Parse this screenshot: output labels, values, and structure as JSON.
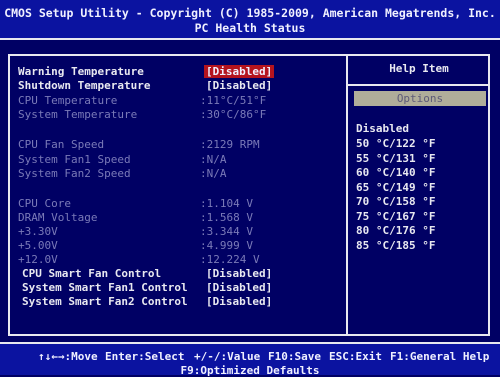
{
  "header": {
    "title": "CMOS Setup Utility - Copyright (C) 1985-2009, American Megatrends, Inc.",
    "subtitle": "PC Health Status"
  },
  "settings": [
    {
      "label": "Warning Temperature",
      "value": "[Disabled]"
    },
    {
      "label": "Shutdown Temperature",
      "value": "[Disabled]"
    },
    {
      "label": "CPU Temperature",
      "value": ":11°C/51°F"
    },
    {
      "label": "System Temperature",
      "value": ":30°C/86°F"
    },
    {
      "label": "CPU Fan Speed",
      "value": ":2129 RPM"
    },
    {
      "label": "System Fan1 Speed",
      "value": ":N/A"
    },
    {
      "label": "System Fan2 Speed",
      "value": ":N/A"
    },
    {
      "label": "CPU Core",
      "value": ":1.104 V"
    },
    {
      "label": "DRAM Voltage",
      "value": ":1.568 V"
    },
    {
      "label": "+3.30V",
      "value": ":3.344 V"
    },
    {
      "label": "+5.00V",
      "value": ":4.999 V"
    },
    {
      "label": "+12.0V",
      "value": ":12.224 V"
    },
    {
      "label": "CPU Smart Fan Control",
      "value": "[Disabled]"
    },
    {
      "label": "System Smart Fan1 Control",
      "value": "[Disabled]"
    },
    {
      "label": "System Smart Fan2 Control",
      "value": "[Disabled]"
    }
  ],
  "help": {
    "title": "Help Item",
    "options_label": "Options",
    "options": [
      "Disabled",
      "50 °C/122 °F",
      "55 °C/131 °F",
      "60 °C/140 °F",
      "65 °C/149 °F",
      "70 °C/158 °F",
      "75 °C/167 °F",
      "80 °C/176 °F",
      "85 °C/185 °F"
    ]
  },
  "footer": {
    "move": "↑↓←→:Move",
    "select": "Enter:Select",
    "value": "+/-/:Value",
    "save": "F10:Save",
    "exit": "ESC:Exit",
    "help": "F1:General Help",
    "defaults": "F9:Optimized Defaults"
  }
}
